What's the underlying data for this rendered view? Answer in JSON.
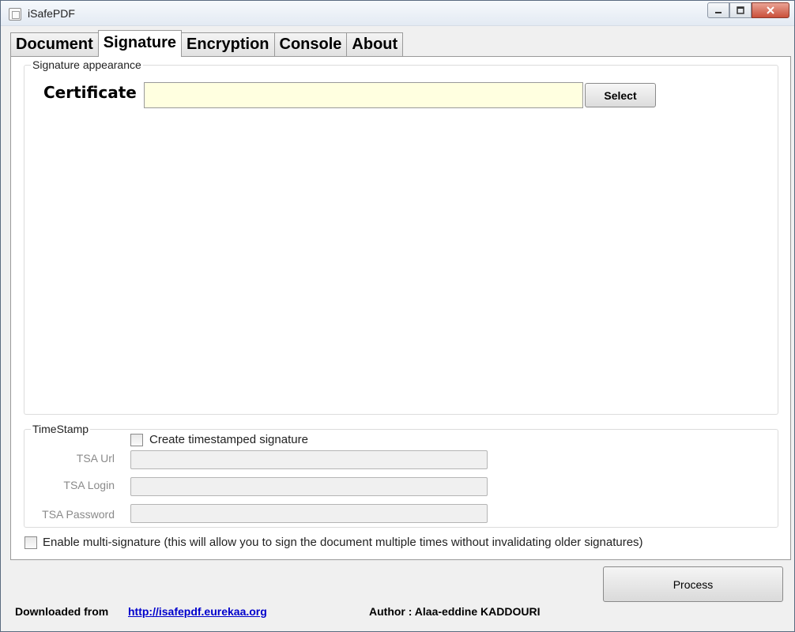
{
  "window": {
    "title": "iSafePDF"
  },
  "tabs": [
    {
      "label": "Document"
    },
    {
      "label": "Signature"
    },
    {
      "label": "Encryption"
    },
    {
      "label": "Console"
    },
    {
      "label": "About"
    }
  ],
  "signature_appearance": {
    "legend": "Signature appearance",
    "certificate_label": "Certificate",
    "certificate_value": "",
    "select_label": "Select"
  },
  "timestamp": {
    "legend": "TimeStamp",
    "create_label": "Create timestamped signature",
    "create_checked": false,
    "tsa_url_label": "TSA Url",
    "tsa_login_label": "TSA Login",
    "tsa_password_label": "TSA Password"
  },
  "multi_signature": {
    "label": "Enable multi-signature (this will allow you to sign the document multiple times without invalidating older signatures)",
    "checked": false
  },
  "process_label": "Process",
  "footer": {
    "downloaded_from": "Downloaded from",
    "link": "http://isafepdf.eurekaa.org",
    "author": "Author : Alaa-eddine KADDOURI"
  },
  "colors": {
    "certificate_field": "#ffffe0",
    "link": "#0000cc"
  }
}
